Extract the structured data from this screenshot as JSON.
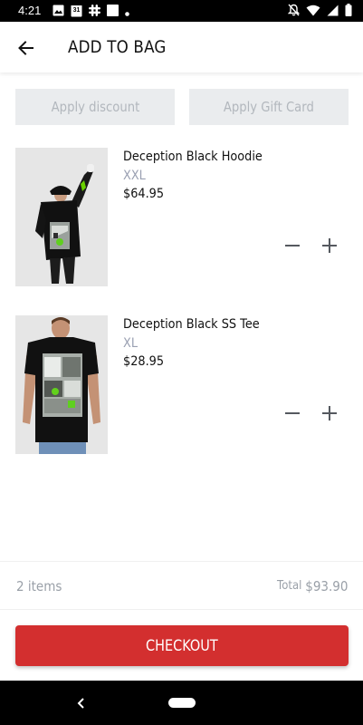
{
  "status_bar": {
    "time": "4:21",
    "calendar_day": "31",
    "left_icons": [
      "image-icon",
      "calendar-icon",
      "slack-icon",
      "square-icon",
      "dot-icon"
    ],
    "right_icons": [
      "mute-icon",
      "wifi-icon",
      "signal-icon",
      "battery-icon"
    ]
  },
  "header": {
    "title": "ADD TO BAG"
  },
  "promo": {
    "discount_label": "Apply discount",
    "gift_card_label": "Apply Gift Card"
  },
  "cart": {
    "items": [
      {
        "name": "Deception Black Hoodie",
        "size": "XXL",
        "price": "$64.95"
      },
      {
        "name": "Deception Black SS Tee",
        "size": "XL",
        "price": "$28.95"
      }
    ]
  },
  "summary": {
    "items_count": "2 items",
    "total_label": "Total",
    "total_value": "$93.90"
  },
  "checkout": {
    "label": "CHECKOUT"
  },
  "colors": {
    "accent": "#d32f2f",
    "muted_text": "#9aa0a8",
    "promo_bg": "#eaecee"
  }
}
